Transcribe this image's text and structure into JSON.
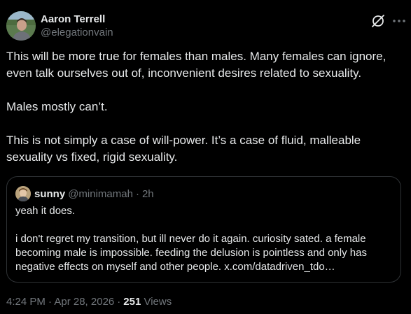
{
  "author": {
    "display_name": "Aaron Terrell",
    "handle": "@elegationvain",
    "avatar_icon": "profile-photo"
  },
  "actions": {
    "grok_icon": "grok-slash-icon",
    "more_icon": "more-dots-icon"
  },
  "body": {
    "paragraphs": [
      "This will be more true for females than males. Many females can ignore, even talk ourselves out of, inconvenient desires related to sexuality.",
      "Males mostly can’t.",
      "This is not simply a case of will-power. It’s a case of fluid, malleable sexuality vs fixed, rigid sexuality."
    ]
  },
  "quote": {
    "display_name": "sunny",
    "handle": "@minimamah",
    "separator": "·",
    "time": "2h",
    "paragraphs": [
      "yeah it does.",
      "i don't regret my transition, but ill never do it again. curiosity sated. a female becoming male is impossible. feeding the delusion is pointless and only has negative effects on myself and other people. x.com/datadriven_tdo…"
    ]
  },
  "meta": {
    "timestamp": "4:24 PM · Apr 28, 2026",
    "separator": "·",
    "views_count": "251",
    "views_label": "Views"
  },
  "colors": {
    "background": "#000000",
    "text_primary": "#e7e9ea",
    "text_secondary": "#71767b",
    "border": "#2f3336"
  }
}
